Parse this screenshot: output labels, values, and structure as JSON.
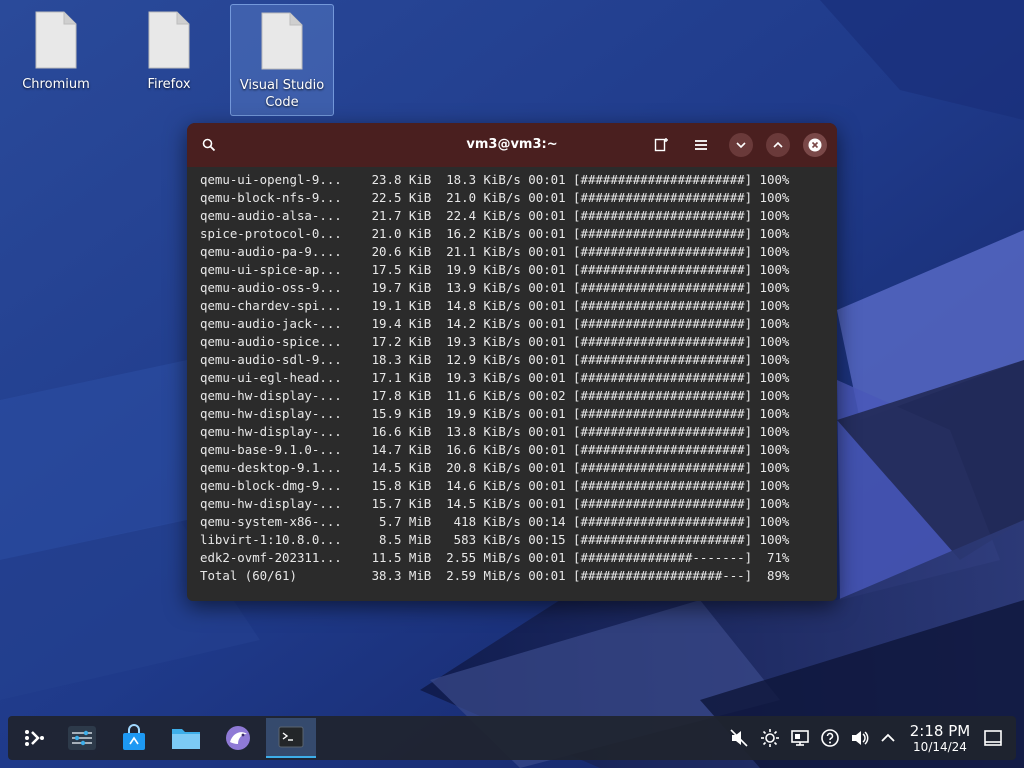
{
  "desktop": {
    "icons": [
      {
        "label": "Chromium"
      },
      {
        "label": "Firefox"
      },
      {
        "label": "Visual Studio\nCode"
      }
    ]
  },
  "terminal": {
    "title": "vm3@vm3:~",
    "lines": [
      {
        "name": "qemu-ui-opengl-9...",
        "size": "23.8 KiB",
        "speed": "18.3 KiB/s",
        "time": "00:01",
        "bar": "[######################]",
        "pct": "100%"
      },
      {
        "name": "qemu-block-nfs-9...",
        "size": "22.5 KiB",
        "speed": "21.0 KiB/s",
        "time": "00:01",
        "bar": "[######################]",
        "pct": "100%"
      },
      {
        "name": "qemu-audio-alsa-...",
        "size": "21.7 KiB",
        "speed": "22.4 KiB/s",
        "time": "00:01",
        "bar": "[######################]",
        "pct": "100%"
      },
      {
        "name": "spice-protocol-0...",
        "size": "21.0 KiB",
        "speed": "16.2 KiB/s",
        "time": "00:01",
        "bar": "[######################]",
        "pct": "100%"
      },
      {
        "name": "qemu-audio-pa-9....",
        "size": "20.6 KiB",
        "speed": "21.1 KiB/s",
        "time": "00:01",
        "bar": "[######################]",
        "pct": "100%"
      },
      {
        "name": "qemu-ui-spice-ap...",
        "size": "17.5 KiB",
        "speed": "19.9 KiB/s",
        "time": "00:01",
        "bar": "[######################]",
        "pct": "100%"
      },
      {
        "name": "qemu-audio-oss-9...",
        "size": "19.7 KiB",
        "speed": "13.9 KiB/s",
        "time": "00:01",
        "bar": "[######################]",
        "pct": "100%"
      },
      {
        "name": "qemu-chardev-spi...",
        "size": "19.1 KiB",
        "speed": "14.8 KiB/s",
        "time": "00:01",
        "bar": "[######################]",
        "pct": "100%"
      },
      {
        "name": "qemu-audio-jack-...",
        "size": "19.4 KiB",
        "speed": "14.2 KiB/s",
        "time": "00:01",
        "bar": "[######################]",
        "pct": "100%"
      },
      {
        "name": "qemu-audio-spice...",
        "size": "17.2 KiB",
        "speed": "19.3 KiB/s",
        "time": "00:01",
        "bar": "[######################]",
        "pct": "100%"
      },
      {
        "name": "qemu-audio-sdl-9...",
        "size": "18.3 KiB",
        "speed": "12.9 KiB/s",
        "time": "00:01",
        "bar": "[######################]",
        "pct": "100%"
      },
      {
        "name": "qemu-ui-egl-head...",
        "size": "17.1 KiB",
        "speed": "19.3 KiB/s",
        "time": "00:01",
        "bar": "[######################]",
        "pct": "100%"
      },
      {
        "name": "qemu-hw-display-...",
        "size": "17.8 KiB",
        "speed": "11.6 KiB/s",
        "time": "00:02",
        "bar": "[######################]",
        "pct": "100%"
      },
      {
        "name": "qemu-hw-display-...",
        "size": "15.9 KiB",
        "speed": "19.9 KiB/s",
        "time": "00:01",
        "bar": "[######################]",
        "pct": "100%"
      },
      {
        "name": "qemu-hw-display-...",
        "size": "16.6 KiB",
        "speed": "13.8 KiB/s",
        "time": "00:01",
        "bar": "[######################]",
        "pct": "100%"
      },
      {
        "name": "qemu-base-9.1.0-...",
        "size": "14.7 KiB",
        "speed": "16.6 KiB/s",
        "time": "00:01",
        "bar": "[######################]",
        "pct": "100%"
      },
      {
        "name": "qemu-desktop-9.1...",
        "size": "14.5 KiB",
        "speed": "20.8 KiB/s",
        "time": "00:01",
        "bar": "[######################]",
        "pct": "100%"
      },
      {
        "name": "qemu-block-dmg-9...",
        "size": "15.8 KiB",
        "speed": "14.6 KiB/s",
        "time": "00:01",
        "bar": "[######################]",
        "pct": "100%"
      },
      {
        "name": "qemu-hw-display-...",
        "size": "15.7 KiB",
        "speed": "14.5 KiB/s",
        "time": "00:01",
        "bar": "[######################]",
        "pct": "100%"
      },
      {
        "name": "qemu-system-x86-...",
        "size": "5.7 MiB",
        "speed": "418 KiB/s",
        "time": "00:14",
        "bar": "[######################]",
        "pct": "100%"
      },
      {
        "name": "libvirt-1:10.8.0...",
        "size": "8.5 MiB",
        "speed": "583 KiB/s",
        "time": "00:15",
        "bar": "[######################]",
        "pct": "100%"
      },
      {
        "name": "edk2-ovmf-202311...",
        "size": "11.5 MiB",
        "speed": "2.55 MiB/s",
        "time": "00:01",
        "bar": "[###############-------]",
        "pct": "71%"
      },
      {
        "name": "Total (60/61)",
        "size": "38.3 MiB",
        "speed": "2.59 MiB/s",
        "time": "00:01",
        "bar": "[###################---]",
        "pct": "89%"
      }
    ]
  },
  "taskbar": {
    "apps": [
      {
        "icon": "app-launcher-icon"
      },
      {
        "icon": "system-settings-icon"
      },
      {
        "icon": "discover-store-icon"
      },
      {
        "icon": "file-manager-icon"
      },
      {
        "icon": "browser-icon"
      },
      {
        "icon": "terminal-icon",
        "active": true
      }
    ],
    "tray": [
      {
        "icon": "audio-muted-icon"
      },
      {
        "icon": "brightness-icon"
      },
      {
        "icon": "display-icon"
      },
      {
        "icon": "help-icon"
      },
      {
        "icon": "volume-icon"
      },
      {
        "icon": "chevron-up-icon"
      }
    ],
    "clock": {
      "time": "2:18 PM",
      "date": "10/14/24"
    }
  },
  "colors": {
    "titlebar": "#4a1f1f",
    "terminal_bg": "#2b2b2b",
    "accent": "#3daee9"
  }
}
